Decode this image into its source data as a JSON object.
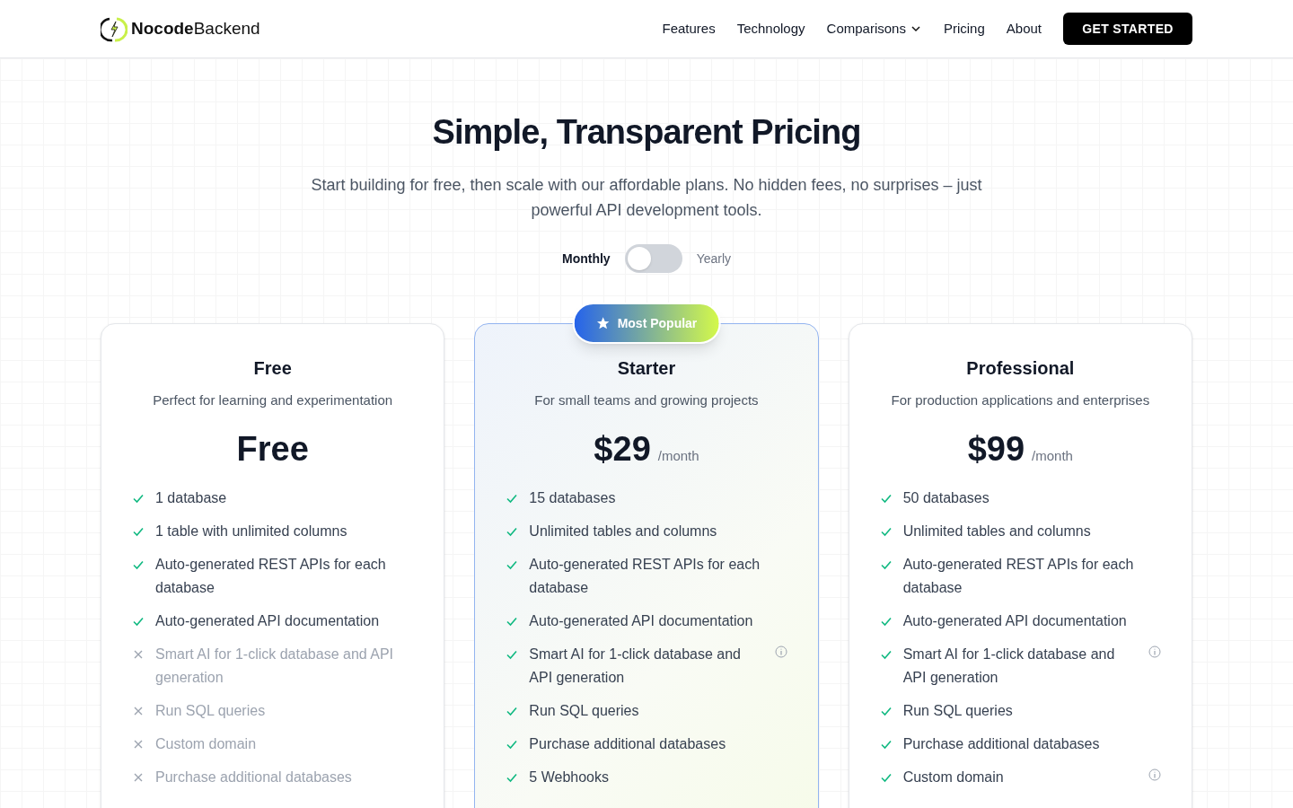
{
  "header": {
    "logo": "**Nocode**Backend",
    "nav": [
      {
        "label": "Features",
        "dropdown": false
      },
      {
        "label": "Technology",
        "dropdown": false
      },
      {
        "label": "Comparisons",
        "dropdown": true
      },
      {
        "label": "Pricing",
        "dropdown": false
      },
      {
        "label": "About",
        "dropdown": false
      }
    ],
    "cta": "GET STARTED"
  },
  "hero": {
    "title": "Simple, Transparent Pricing",
    "subtitle": "Start building for free, then scale with our affordable plans. No hidden fees, no surprises – just powerful API development tools."
  },
  "billing": {
    "options": [
      {
        "label": "Monthly",
        "selected": true
      },
      {
        "label": "Yearly",
        "selected": false
      }
    ],
    "toggle_on": false
  },
  "plans": [
    {
      "name": "Free",
      "description": "Perfect for learning and experimentation",
      "price": "Free",
      "highlighted": false,
      "features": [
        {
          "text": "1 database",
          "included": true,
          "info": false
        },
        {
          "text": "1 table with unlimited columns",
          "included": true,
          "info": false
        },
        {
          "text": "Auto-generated REST APIs for each database",
          "included": true,
          "info": false
        },
        {
          "text": "Auto-generated API documentation",
          "included": true,
          "info": false
        },
        {
          "text": "Smart AI for 1-click database and API generation",
          "included": false,
          "info": false
        },
        {
          "text": "Run SQL queries",
          "included": false,
          "info": false
        },
        {
          "text": "Custom domain",
          "included": false,
          "info": false
        },
        {
          "text": "Purchase additional databases",
          "included": false,
          "info": false
        }
      ]
    },
    {
      "name": "Starter",
      "description": "For small teams and growing projects",
      "price": "$29",
      "period": "/month",
      "highlighted": true,
      "badge": "Most Popular",
      "features": [
        {
          "text": "15 databases",
          "included": true,
          "info": false
        },
        {
          "text": "Unlimited tables and columns",
          "included": true,
          "info": false
        },
        {
          "text": "Auto-generated REST APIs for each database",
          "included": true,
          "info": false
        },
        {
          "text": "Auto-generated API documentation",
          "included": true,
          "info": false
        },
        {
          "text": "Smart AI for 1-click database and API generation",
          "included": true,
          "info": true
        },
        {
          "text": "Run SQL queries",
          "included": true,
          "info": false
        },
        {
          "text": "Purchase additional databases",
          "included": true,
          "info": false
        },
        {
          "text": "5 Webhooks",
          "included": true,
          "info": false
        }
      ]
    },
    {
      "name": "Professional",
      "description": "For production applications and enterprises",
      "price": "$99",
      "period": "/month",
      "highlighted": false,
      "features": [
        {
          "text": "50 databases",
          "included": true,
          "info": false
        },
        {
          "text": "Unlimited tables and columns",
          "included": true,
          "info": false
        },
        {
          "text": "Auto-generated REST APIs for each database",
          "included": true,
          "info": false
        },
        {
          "text": "Auto-generated API documentation",
          "included": true,
          "info": false
        },
        {
          "text": "Smart AI for 1-click database and API generation",
          "included": true,
          "info": true
        },
        {
          "text": "Run SQL queries",
          "included": true,
          "info": false
        },
        {
          "text": "Purchase additional databases",
          "included": true,
          "info": false
        },
        {
          "text": "Custom domain",
          "included": true,
          "info": true
        }
      ]
    }
  ]
}
